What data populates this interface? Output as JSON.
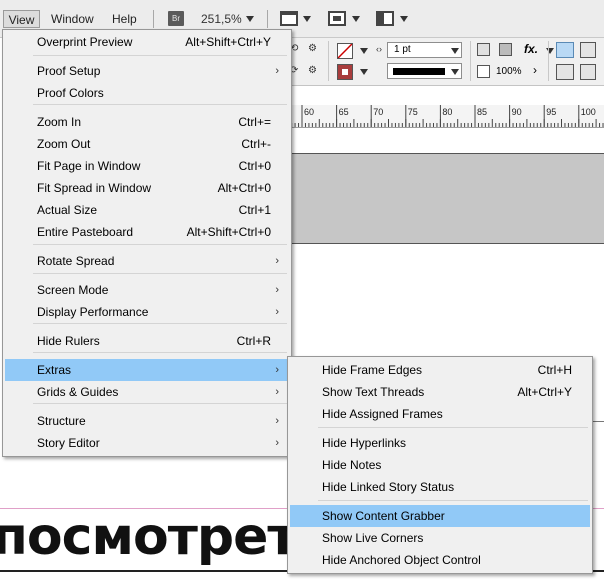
{
  "menubar": {
    "view": "View",
    "window": "Window",
    "help": "Help",
    "br_badge": "Br",
    "zoom": "251,5%"
  },
  "control": {
    "stroke_weight": "1 pt",
    "scale": "100%",
    "fx_label": "fx."
  },
  "ruler": {
    "labels": [
      "60",
      "65",
      "70",
      "75",
      "80",
      "85",
      "90",
      "95",
      "100"
    ]
  },
  "document_text": "посмотреть",
  "view_menu": [
    {
      "label": "Overprint Preview",
      "shortcut": "Alt+Shift+Ctrl+Y",
      "submenu": false
    },
    {
      "label": "Proof Setup",
      "shortcut": "",
      "submenu": true
    },
    {
      "label": "Proof Colors",
      "shortcut": "",
      "submenu": false
    },
    {
      "label": "Zoom In",
      "shortcut": "Ctrl+=",
      "submenu": false
    },
    {
      "label": "Zoom Out",
      "shortcut": "Ctrl+-",
      "submenu": false
    },
    {
      "label": "Fit Page in Window",
      "shortcut": "Ctrl+0",
      "submenu": false
    },
    {
      "label": "Fit Spread in Window",
      "shortcut": "Alt+Ctrl+0",
      "submenu": false
    },
    {
      "label": "Actual Size",
      "shortcut": "Ctrl+1",
      "submenu": false
    },
    {
      "label": "Entire Pasteboard",
      "shortcut": "Alt+Shift+Ctrl+0",
      "submenu": false
    },
    {
      "label": "Rotate Spread",
      "shortcut": "",
      "submenu": true
    },
    {
      "label": "Screen Mode",
      "shortcut": "",
      "submenu": true
    },
    {
      "label": "Display Performance",
      "shortcut": "",
      "submenu": true
    },
    {
      "label": "Hide Rulers",
      "shortcut": "Ctrl+R",
      "submenu": false
    },
    {
      "label": "Extras",
      "shortcut": "",
      "submenu": true,
      "highlighted": true
    },
    {
      "label": "Grids & Guides",
      "shortcut": "",
      "submenu": true
    },
    {
      "label": "Structure",
      "shortcut": "",
      "submenu": true
    },
    {
      "label": "Story Editor",
      "shortcut": "",
      "submenu": true
    }
  ],
  "extras_menu": [
    {
      "label": "Hide Frame Edges",
      "shortcut": "Ctrl+H"
    },
    {
      "label": "Show Text Threads",
      "shortcut": "Alt+Ctrl+Y"
    },
    {
      "label": "Hide Assigned Frames",
      "shortcut": ""
    },
    {
      "label": "Hide Hyperlinks",
      "shortcut": ""
    },
    {
      "label": "Hide Notes",
      "shortcut": ""
    },
    {
      "label": "Hide Linked Story Status",
      "shortcut": ""
    },
    {
      "label": "Show Content Grabber",
      "shortcut": "",
      "highlighted": true
    },
    {
      "label": "Show Live Corners",
      "shortcut": ""
    },
    {
      "label": "Hide Anchored Object Control",
      "shortcut": ""
    }
  ],
  "colors": {
    "highlight": "#91c9f7",
    "menu_bg": "#f0f0f0",
    "stroke_swatch": "#a83c3c"
  }
}
